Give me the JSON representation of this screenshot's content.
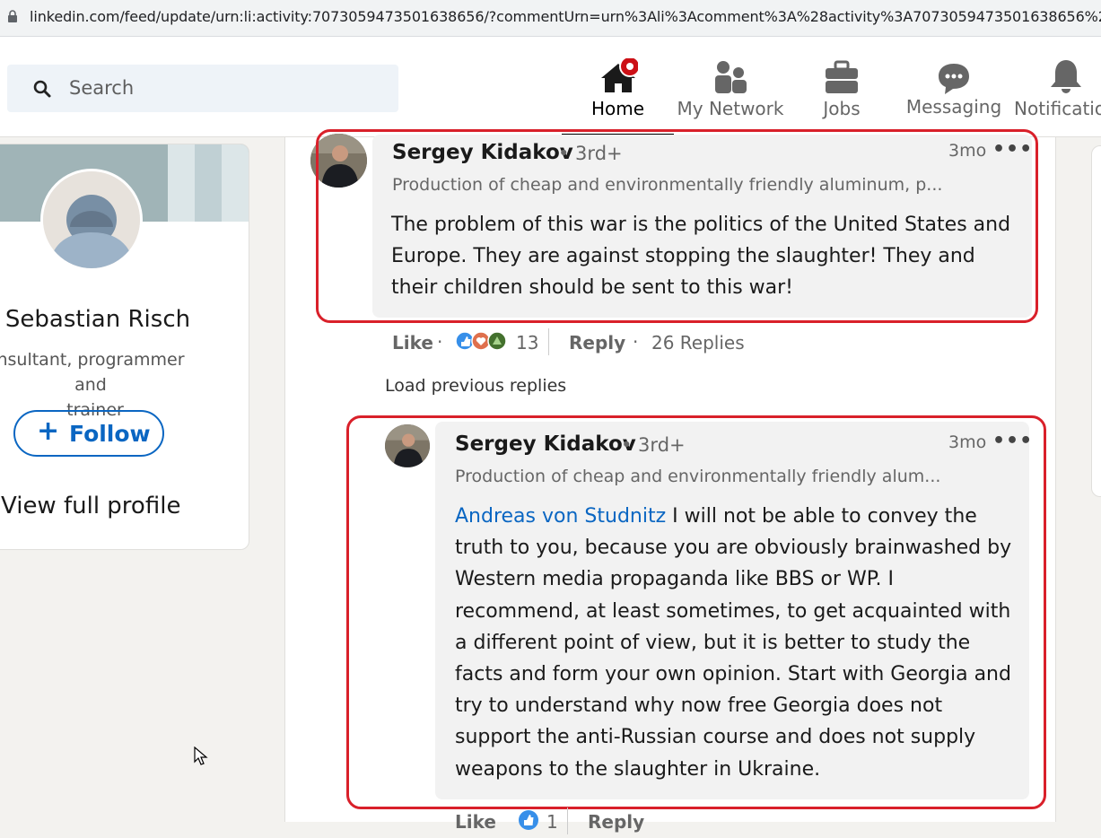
{
  "browser": {
    "url": "linkedin.com/feed/update/urn:li:activity:7073059473501638656/?commentUrn=urn%3Ali%3Acomment%3A%28activity%3A7073059473501638656%2C707..."
  },
  "nav": {
    "search_placeholder": "Search",
    "items": [
      {
        "label": "Home",
        "icon": "home-icon"
      },
      {
        "label": "My Network",
        "icon": "network-icon"
      },
      {
        "label": "Jobs",
        "icon": "briefcase-icon"
      },
      {
        "label": "Messaging",
        "icon": "messaging-icon"
      },
      {
        "label": "Notificatio",
        "icon": "bell-icon"
      }
    ],
    "home_badge": "notification-dot"
  },
  "profile_card": {
    "name": "Sebastian Risch",
    "headline_line1": "nsultant, programmer and",
    "headline_line2": "trainer",
    "follow_label": "Follow",
    "follow_plus": "+",
    "view_profile": "View full profile"
  },
  "comments": [
    {
      "author": "Sergey Kidakov",
      "degree": "• 3rd+",
      "time": "3mo",
      "more": "•••",
      "headline": "Production of cheap and environmentally friendly aluminum, p...",
      "text_lines": [
        "The problem of this war is the politics of the United States and",
        "Europe. They are against stopping the slaughter! They and",
        "their children should be sent to this war!"
      ],
      "actions": {
        "like": "Like",
        "dot1": "·",
        "reaction_count": "13",
        "reply": "Reply",
        "dot2": "·",
        "replies": "26 Replies"
      }
    },
    {
      "author": "Sergey Kidakov",
      "degree": "• 3rd+",
      "time": "3mo",
      "more": "•••",
      "headline": "Production of cheap and environmentally friendly alum...",
      "mention": "Andreas von Studnitz",
      "text_line1_rest": " I will not be able to convey the",
      "text_lines": [
        "truth to you, because you are obviously brainwashed by",
        "Western media propaganda like BBS or WP. I",
        "recommend, at least sometimes, to get acquainted with",
        "a different point of view, but it is better to study the",
        "facts and form your own opinion. Start with Georgia and",
        "try to understand why now free Georgia does not",
        "support the anti-Russian course and does not supply",
        "weapons to the slaughter in Ukraine."
      ],
      "actions": {
        "like": "Like",
        "reaction_count": "1",
        "reply": "Reply"
      }
    }
  ],
  "load_previous": "Load previous replies",
  "colors": {
    "accent": "#0a66c2",
    "highlight": "#d9202a",
    "badge": "#cc1016"
  }
}
